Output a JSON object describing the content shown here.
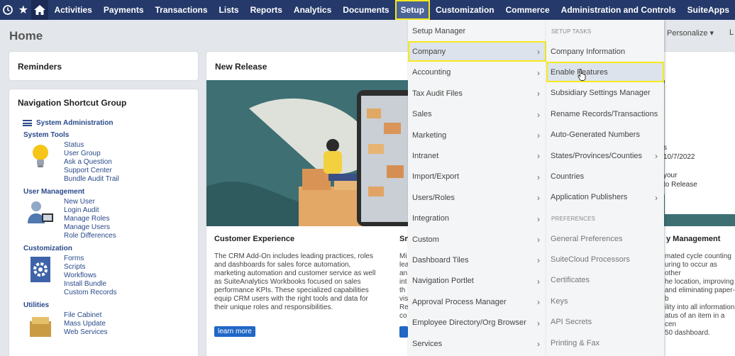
{
  "nav": {
    "items": [
      "Activities",
      "Payments",
      "Transactions",
      "Lists",
      "Reports",
      "Analytics",
      "Documents",
      "Setup",
      "Customization",
      "Commerce",
      "Administration and Controls",
      "SuiteApps"
    ],
    "active": "Setup"
  },
  "page": {
    "title": "Home",
    "personalize": "Personalize ▾",
    "personalize_tail": "L"
  },
  "reminders": {
    "title": "Reminders"
  },
  "nav_group": {
    "title": "Navigation Shortcut Group",
    "sysadmin": "System Administration",
    "sections": [
      {
        "title": "System Tools",
        "icon": "lightbulb-icon",
        "links": [
          "Status",
          "User Group",
          "Ask a Question",
          "Support Center",
          "Bundle Audit Trail"
        ]
      },
      {
        "title": "User Management",
        "icon": "users-icon",
        "links": [
          "New User",
          "Login Audit",
          "Manage Roles",
          "Manage Users",
          "Role Differences"
        ]
      },
      {
        "title": "Customization",
        "icon": "gear-doc-icon",
        "links": [
          "Forms",
          "Scripts",
          "Workflows",
          "Install Bundle",
          "Custom Records"
        ]
      },
      {
        "title": "Utilities",
        "icon": "cabinet-icon",
        "links": [
          "File Cabinet",
          "Mass Update",
          "Web Services"
        ]
      }
    ]
  },
  "release": {
    "title": "New Release",
    "col1_title": "Customer Experience",
    "col1_body": "The CRM Add-On includes leading practices, roles and dashboards for sales force automation, marketing automation and customer service as well as SuiteAnalytics Workbooks focused on sales performance KPIs. These specialized capabilities equip CRM users with the right tools and data for their unique roles and responsibilities.",
    "col1_button": "learn more",
    "col2_title": "Sn",
    "col2_body": "Mi\nlea\nan\nint\nth\nvis\nRe\nco",
    "col3_title": "y Management",
    "col3_body": "mated cycle counting\nuring to occur as other\nhe location, improving\nand eliminating paper-b\nility into all information\natus of an item in a cen\n50 dashboard.",
    "peek_text": "s\n10/7/2022\n\nyour\nto Release"
  },
  "menu1": [
    {
      "label": "Setup Manager",
      "arrow": false
    },
    {
      "label": "Company",
      "arrow": true
    },
    {
      "label": "Accounting",
      "arrow": true
    },
    {
      "label": "Tax Audit Files",
      "arrow": true
    },
    {
      "label": "Sales",
      "arrow": true
    },
    {
      "label": "Marketing",
      "arrow": true
    },
    {
      "label": "Intranet",
      "arrow": true
    },
    {
      "label": "Import/Export",
      "arrow": true
    },
    {
      "label": "Users/Roles",
      "arrow": true
    },
    {
      "label": "Integration",
      "arrow": true
    },
    {
      "label": "Custom",
      "arrow": true
    },
    {
      "label": "Dashboard Tiles",
      "arrow": true
    },
    {
      "label": "Navigation Portlet",
      "arrow": true
    },
    {
      "label": "Approval Process Manager",
      "arrow": true
    },
    {
      "label": "Employee Directory/Org Browser",
      "arrow": true
    },
    {
      "label": "Services",
      "arrow": true
    }
  ],
  "menu1_highlight": "Company",
  "menu2": {
    "head1": "SETUP TASKS",
    "items1": [
      {
        "label": "Company Information",
        "arrow": false
      },
      {
        "label": "Enable Features",
        "arrow": false
      },
      {
        "label": "Subsidiary Settings Manager",
        "arrow": false
      },
      {
        "label": "Rename Records/Transactions",
        "arrow": false
      },
      {
        "label": "Auto-Generated Numbers",
        "arrow": false
      },
      {
        "label": "States/Provinces/Counties",
        "arrow": true
      },
      {
        "label": "Countries",
        "arrow": false
      },
      {
        "label": "Application Publishers",
        "arrow": true
      }
    ],
    "head2": "PREFERENCES",
    "items2": [
      {
        "label": "General Preferences",
        "arrow": false
      },
      {
        "label": "SuiteCloud Processors",
        "arrow": false
      },
      {
        "label": "Certificates",
        "arrow": false
      },
      {
        "label": "Keys",
        "arrow": false
      },
      {
        "label": "API Secrets",
        "arrow": false
      },
      {
        "label": "Printing & Fax",
        "arrow": false
      }
    ]
  },
  "menu2_highlight": "Enable Features",
  "colors": {
    "nav_bg": "#25396a",
    "highlight": "#f4ea1d",
    "link": "#2a4a8a",
    "teal": "#3d6f73"
  }
}
